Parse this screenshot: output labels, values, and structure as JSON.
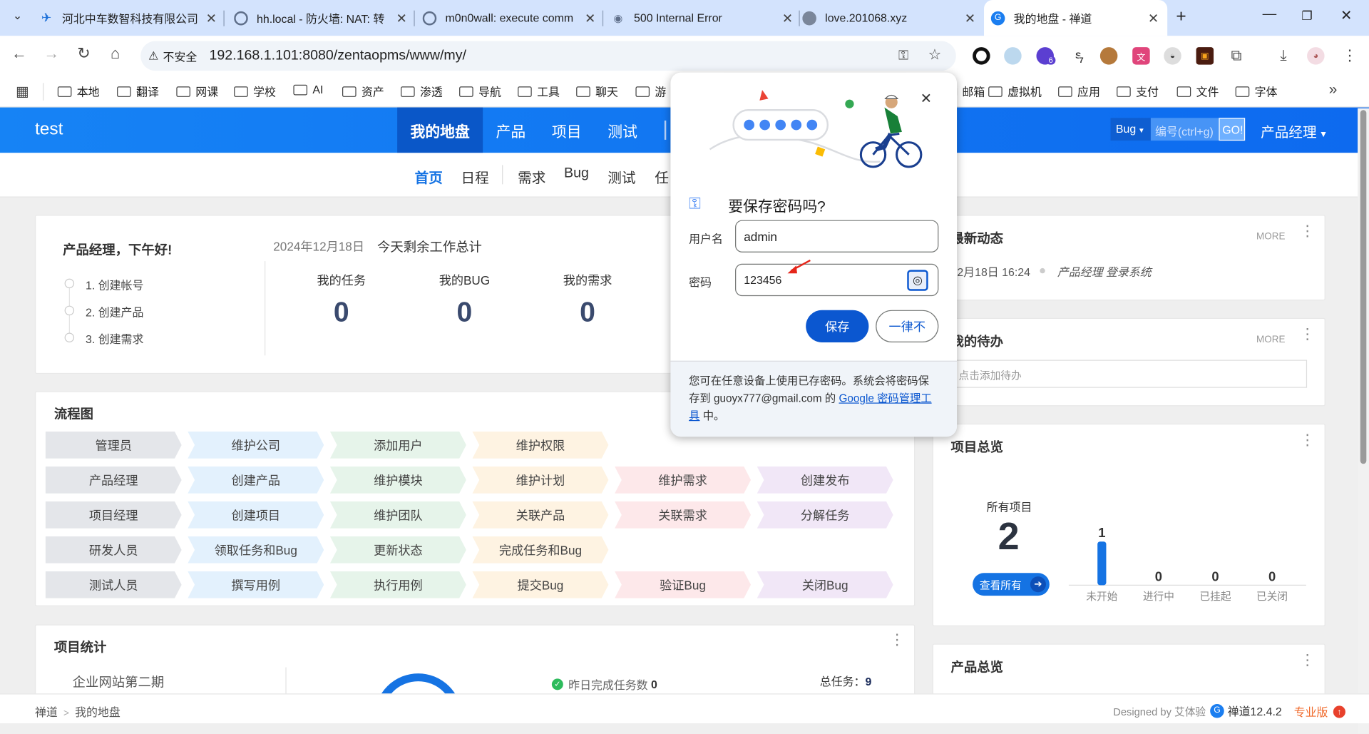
{
  "tabs": [
    {
      "title": "河北中车数智科技有限公司",
      "icon": "bird-icon"
    },
    {
      "title": "hh.local - 防火墙: NAT: 转",
      "icon": "globe-icon"
    },
    {
      "title": "m0n0wall: execute comm",
      "icon": "globe-icon"
    },
    {
      "title": "500 Internal Error",
      "icon": "eye-icon"
    },
    {
      "title": "love.201068.xyz",
      "icon": "globe-icon"
    },
    {
      "title": "我的地盘 - 禅道",
      "icon": "zentao-icon",
      "active": true
    }
  ],
  "address": {
    "security_label": "不安全",
    "url": "192.168.1.101:8080/zentaopms/www/my/"
  },
  "extensions": {
    "badge_a": "6",
    "badge_b": "7"
  },
  "bookmarks": [
    "本地",
    "翻译",
    "网课",
    "学校",
    "AI",
    "资产",
    "渗透",
    "导航",
    "工具",
    "聊天",
    "游",
    "邮箱",
    "虚拟机",
    "应用",
    "支付",
    "文件",
    "字体"
  ],
  "app": {
    "name": "test",
    "nav": [
      "我的地盘",
      "产品",
      "项目",
      "测试"
    ],
    "search_type": "Bug",
    "search_placeholder": "编号(ctrl+g)",
    "search_go": "GO!",
    "user_role": "产品经理"
  },
  "subnav": [
    "首页",
    "日程",
    "需求",
    "Bug",
    "测试",
    "任"
  ],
  "welcome": {
    "greeting": "产品经理，下午好!",
    "date": "2024年12月18日",
    "summary_title": "今天剩余工作总计",
    "steps": [
      "1. 创建帐号",
      "2. 创建产品",
      "3. 创建需求"
    ],
    "stats": [
      {
        "label": "我的任务",
        "value": "0"
      },
      {
        "label": "我的BUG",
        "value": "0"
      },
      {
        "label": "我的需求",
        "value": "0"
      }
    ]
  },
  "flow": {
    "title": "流程图",
    "rows": [
      {
        "role": "管理员",
        "steps": [
          "维护公司",
          "添加用户",
          "维护权限"
        ]
      },
      {
        "role": "产品经理",
        "steps": [
          "创建产品",
          "维护模块",
          "维护计划",
          "维护需求",
          "创建发布"
        ]
      },
      {
        "role": "项目经理",
        "steps": [
          "创建项目",
          "维护团队",
          "关联产品",
          "关联需求",
          "分解任务"
        ]
      },
      {
        "role": "研发人员",
        "steps": [
          "领取任务和Bug",
          "更新状态",
          "完成任务和Bug"
        ]
      },
      {
        "role": "测试人员",
        "steps": [
          "撰写用例",
          "执行用例",
          "提交Bug",
          "验证Bug",
          "关闭Bug"
        ]
      }
    ]
  },
  "project_stats": {
    "title": "项目统计",
    "project_name": "企业网站第二期",
    "yesterday_label": "昨日完成任务数",
    "yesterday_value": "0",
    "total_label": "总任务：",
    "total_value": "9"
  },
  "dynamics": {
    "title": "最新动态",
    "more": "MORE",
    "time": "12月18日 16:24",
    "text": "产品经理 登录系统"
  },
  "todo": {
    "title": "我的待办",
    "more": "MORE",
    "placeholder": "点击添加待办"
  },
  "project_overview": {
    "title": "项目总览",
    "all_label": "所有项目",
    "all_value": "2",
    "view_all": "查看所有",
    "chart_data": {
      "type": "bar",
      "categories": [
        "未开始",
        "进行中",
        "已挂起",
        "已关闭"
      ],
      "values": [
        1,
        0,
        0,
        0
      ],
      "data_labels": [
        "1",
        "0",
        "0",
        "0"
      ]
    }
  },
  "product_overview": {
    "title": "产品总览"
  },
  "password_dialog": {
    "title": "要保存密码吗?",
    "username_label": "用户名",
    "username": "admin",
    "password_label": "密码",
    "password": "123456",
    "save": "保存",
    "never": "一律不",
    "footer_text": "您可在任意设备上使用已存密码。系统会将密码保存到 guoyx777@gmail.com 的",
    "footer_link": "Google 密码管理工具",
    "footer_end": "中。"
  },
  "footer": {
    "crumb_root": "禅道",
    "crumb_current": "我的地盘",
    "designed_by": "Designed by 艾体验",
    "version": "禅道12.4.2",
    "edition": "专业版"
  },
  "colors": {
    "header": "#1683f5",
    "accent": "#0b57d0",
    "pro": "#f06a2b"
  }
}
